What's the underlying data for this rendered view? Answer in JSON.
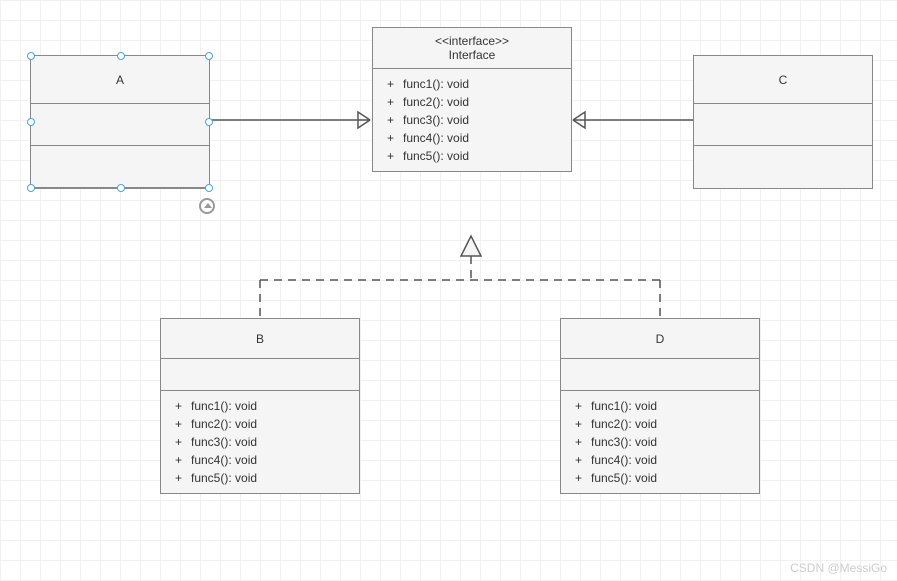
{
  "chart_data": {
    "type": "uml-class-diagram",
    "classes": [
      {
        "id": "Interface",
        "stereotype": "<<interface>>",
        "name": "Interface",
        "attributes": [],
        "methods": [
          {
            "visibility": "+",
            "signature": "func1(): void"
          },
          {
            "visibility": "+",
            "signature": "func2(): void"
          },
          {
            "visibility": "+",
            "signature": "func3(): void"
          },
          {
            "visibility": "+",
            "signature": "func4(): void"
          },
          {
            "visibility": "+",
            "signature": "func5(): void"
          }
        ]
      },
      {
        "id": "A",
        "name": "A",
        "attributes": [],
        "methods": [],
        "selected": true
      },
      {
        "id": "C",
        "name": "C",
        "attributes": [],
        "methods": []
      },
      {
        "id": "B",
        "name": "B",
        "attributes": [],
        "methods": [
          {
            "visibility": "+",
            "signature": "func1(): void"
          },
          {
            "visibility": "+",
            "signature": "func2(): void"
          },
          {
            "visibility": "+",
            "signature": "func3(): void"
          },
          {
            "visibility": "+",
            "signature": "func4(): void"
          },
          {
            "visibility": "+",
            "signature": "func5(): void"
          }
        ]
      },
      {
        "id": "D",
        "name": "D",
        "attributes": [],
        "methods": [
          {
            "visibility": "+",
            "signature": "func1(): void"
          },
          {
            "visibility": "+",
            "signature": "func2(): void"
          },
          {
            "visibility": "+",
            "signature": "func3(): void"
          },
          {
            "visibility": "+",
            "signature": "func4(): void"
          },
          {
            "visibility": "+",
            "signature": "func5(): void"
          }
        ]
      }
    ],
    "relationships": [
      {
        "from": "A",
        "to": "Interface",
        "type": "dependency-solid-open-arrow"
      },
      {
        "from": "C",
        "to": "Interface",
        "type": "dependency-solid-open-arrow"
      },
      {
        "from": "B",
        "to": "Interface",
        "type": "realization-dashed-hollow-triangle"
      },
      {
        "from": "D",
        "to": "Interface",
        "type": "realization-dashed-hollow-triangle"
      }
    ]
  },
  "watermark": "CSDN @MessiGo"
}
